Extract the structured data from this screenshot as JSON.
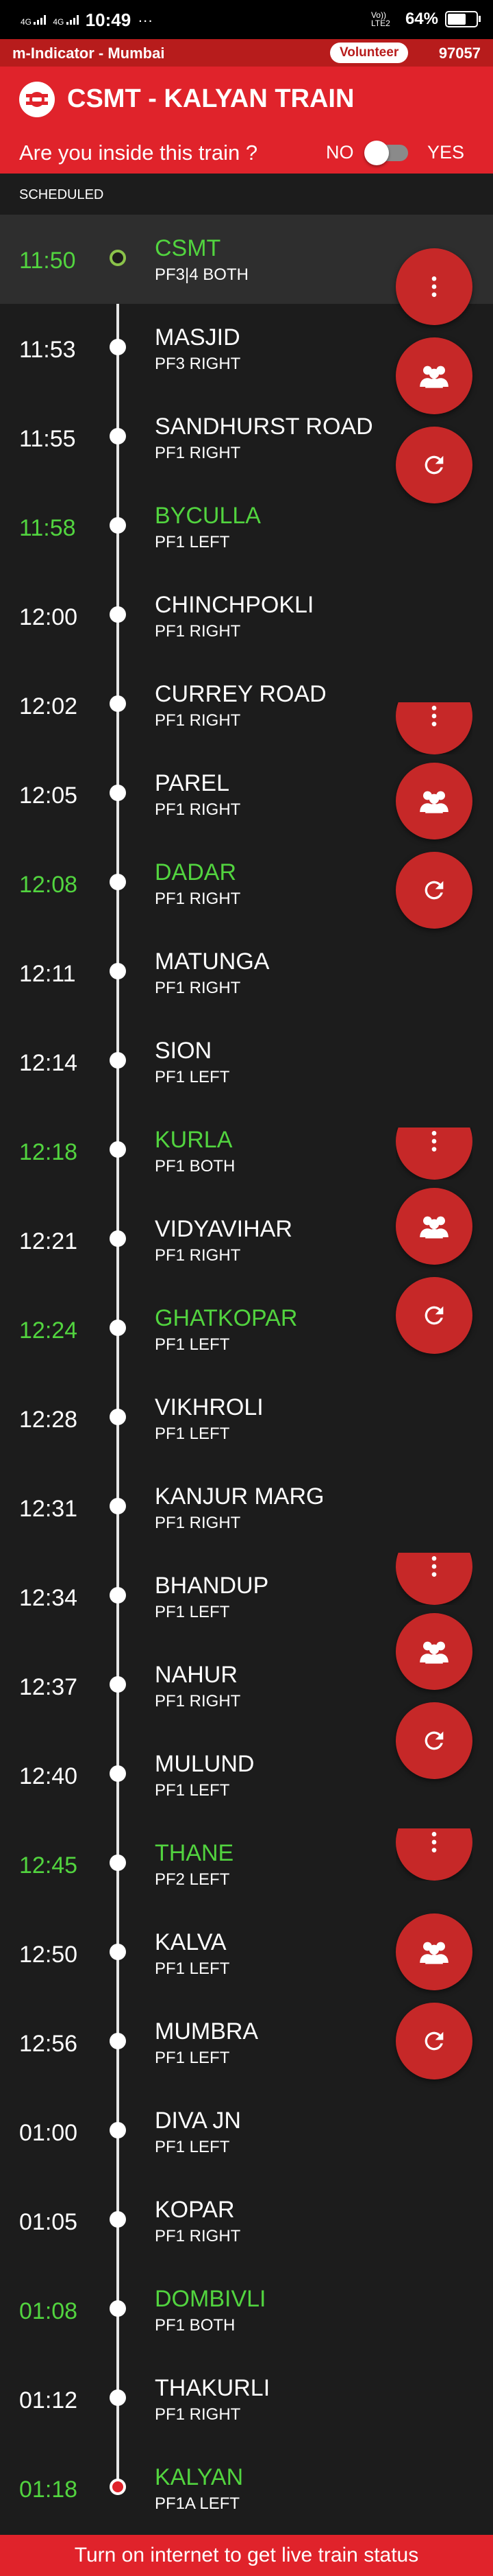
{
  "status_bar": {
    "network1": "4G",
    "network2": "4G",
    "time": "10:49",
    "more": "···",
    "carrier": "Vo)) LTE2",
    "battery": "64%",
    "battery_level": 0.64
  },
  "app_bar": {
    "name": "m-Indicator - Mumbai",
    "volunteer_label": "Volunteer",
    "code": "97057"
  },
  "header": {
    "title": "CSMT - KALYAN TRAIN",
    "inside_question": "Are you inside this train ?",
    "no_label": "NO",
    "yes_label": "YES"
  },
  "scheduled_label": "SCHEDULED",
  "stations": [
    {
      "time": "11:50",
      "name": "CSMT",
      "platform": "PF3|4 BOTH",
      "highlight": true
    },
    {
      "time": "11:53",
      "name": "MASJID",
      "platform": "PF3 RIGHT",
      "highlight": false
    },
    {
      "time": "11:55",
      "name": "SANDHURST ROAD",
      "platform": "PF1 RIGHT",
      "highlight": false
    },
    {
      "time": "11:58",
      "name": "BYCULLA",
      "platform": "PF1 LEFT",
      "highlight": true
    },
    {
      "time": "12:00",
      "name": "CHINCHPOKLI",
      "platform": "PF1 RIGHT",
      "highlight": false
    },
    {
      "time": "12:02",
      "name": "CURREY ROAD",
      "platform": "PF1 RIGHT",
      "highlight": false
    },
    {
      "time": "12:05",
      "name": "PAREL",
      "platform": "PF1 RIGHT",
      "highlight": false
    },
    {
      "time": "12:08",
      "name": "DADAR",
      "platform": "PF1 RIGHT",
      "highlight": true
    },
    {
      "time": "12:11",
      "name": "MATUNGA",
      "platform": "PF1 RIGHT",
      "highlight": false
    },
    {
      "time": "12:14",
      "name": "SION",
      "platform": "PF1 LEFT",
      "highlight": false
    },
    {
      "time": "12:18",
      "name": "KURLA",
      "platform": "PF1 BOTH",
      "highlight": true
    },
    {
      "time": "12:21",
      "name": "VIDYAVIHAR",
      "platform": "PF1 RIGHT",
      "highlight": false
    },
    {
      "time": "12:24",
      "name": "GHATKOPAR",
      "platform": "PF1 LEFT",
      "highlight": true
    },
    {
      "time": "12:28",
      "name": "VIKHROLI",
      "platform": "PF1 LEFT",
      "highlight": false
    },
    {
      "time": "12:31",
      "name": "KANJUR MARG",
      "platform": "PF1 RIGHT",
      "highlight": false
    },
    {
      "time": "12:34",
      "name": "BHANDUP",
      "platform": "PF1 LEFT",
      "highlight": false
    },
    {
      "time": "12:37",
      "name": "NAHUR",
      "platform": "PF1 RIGHT",
      "highlight": false
    },
    {
      "time": "12:40",
      "name": "MULUND",
      "platform": "PF1 LEFT",
      "highlight": false
    },
    {
      "time": "12:45",
      "name": "THANE",
      "platform": "PF2 LEFT",
      "highlight": true
    },
    {
      "time": "12:50",
      "name": "KALVA",
      "platform": "PF1 LEFT",
      "highlight": false
    },
    {
      "time": "12:56",
      "name": "MUMBRA",
      "platform": "PF1 LEFT",
      "highlight": false
    },
    {
      "time": "01:00",
      "name": "DIVA JN",
      "platform": "PF1 LEFT",
      "highlight": false
    },
    {
      "time": "01:05",
      "name": "KOPAR",
      "platform": "PF1 RIGHT",
      "highlight": false
    },
    {
      "time": "01:08",
      "name": "DOMBIVLI",
      "platform": "PF1 BOTH",
      "highlight": true
    },
    {
      "time": "01:12",
      "name": "THAKURLI",
      "platform": "PF1 RIGHT",
      "highlight": false
    },
    {
      "time": "01:18",
      "name": "KALYAN",
      "platform": "PF1A LEFT",
      "highlight": true
    }
  ],
  "fab_icons": [
    "more-vert-icon",
    "group-icon",
    "refresh-icon"
  ],
  "bottom_banner": "Turn on internet to get live train status",
  "colors": {
    "accent_red": "#e0232b",
    "highlight_green": "#52d43f",
    "background": "#1c1c1c"
  }
}
